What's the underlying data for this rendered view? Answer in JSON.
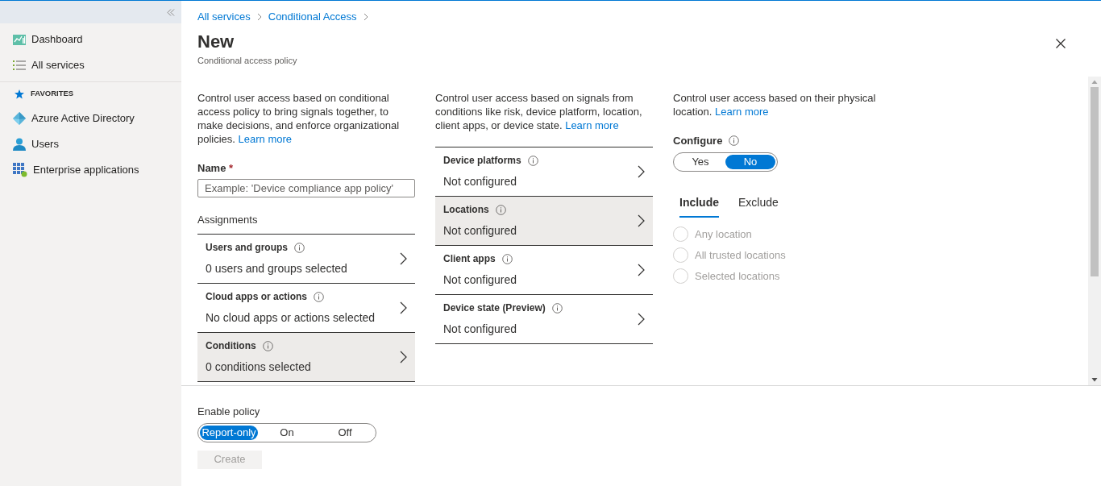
{
  "sidebar": {
    "items": [
      {
        "label": "Dashboard"
      },
      {
        "label": "All services"
      }
    ],
    "favorites": {
      "heading": "FAVORITES",
      "items": [
        {
          "label": "Azure Active Directory"
        },
        {
          "label": "Users"
        },
        {
          "label": "Enterprise applications"
        }
      ]
    }
  },
  "breadcrumb": [
    "All services",
    "Conditional Access"
  ],
  "title": "New",
  "subtitle": "Conditional access policy",
  "assignments": {
    "description": "Control user access based on conditional access policy to bring signals together, to make decisions, and enforce organizational policies.",
    "learn_more": "Learn more",
    "name_field": {
      "label": "Name",
      "required_mark": "*",
      "placeholder": "Example: 'Device compliance app policy'"
    },
    "heading": "Assignments",
    "items": [
      {
        "title": "Users and groups",
        "value": "0 users and groups selected",
        "selected": false
      },
      {
        "title": "Cloud apps or actions",
        "value": "No cloud apps or actions selected",
        "selected": false
      },
      {
        "title": "Conditions",
        "value": "0 conditions selected",
        "selected": true
      }
    ]
  },
  "conditions": {
    "description": "Control user access based on signals from conditions like risk, device platform, location, client apps, or device state.",
    "learn_more": "Learn more",
    "items": [
      {
        "title": "Device platforms",
        "value": "Not configured",
        "selected": false
      },
      {
        "title": "Locations",
        "value": "Not configured",
        "selected": true
      },
      {
        "title": "Client apps",
        "value": "Not configured",
        "selected": false
      },
      {
        "title": "Device state (Preview)",
        "value": "Not configured",
        "selected": false
      }
    ]
  },
  "locations": {
    "description": "Control user access based on their physical location.",
    "learn_more": "Learn more",
    "configure": {
      "label": "Configure",
      "options": [
        {
          "label": "Yes",
          "selected": false
        },
        {
          "label": "No",
          "selected": true
        }
      ]
    },
    "tabs": [
      {
        "label": "Include",
        "selected": true
      },
      {
        "label": "Exclude",
        "selected": false
      }
    ],
    "options": [
      {
        "label": "Any location",
        "selected": false,
        "disabled": true
      },
      {
        "label": "All trusted locations",
        "selected": false,
        "disabled": true
      },
      {
        "label": "Selected locations",
        "selected": false,
        "disabled": true
      }
    ]
  },
  "enable_policy": {
    "label": "Enable policy",
    "options": [
      {
        "label": "Report-only",
        "selected": true
      },
      {
        "label": "On",
        "selected": false
      },
      {
        "label": "Off",
        "selected": false
      }
    ]
  },
  "create_button": {
    "label": "Create",
    "disabled": true
  }
}
